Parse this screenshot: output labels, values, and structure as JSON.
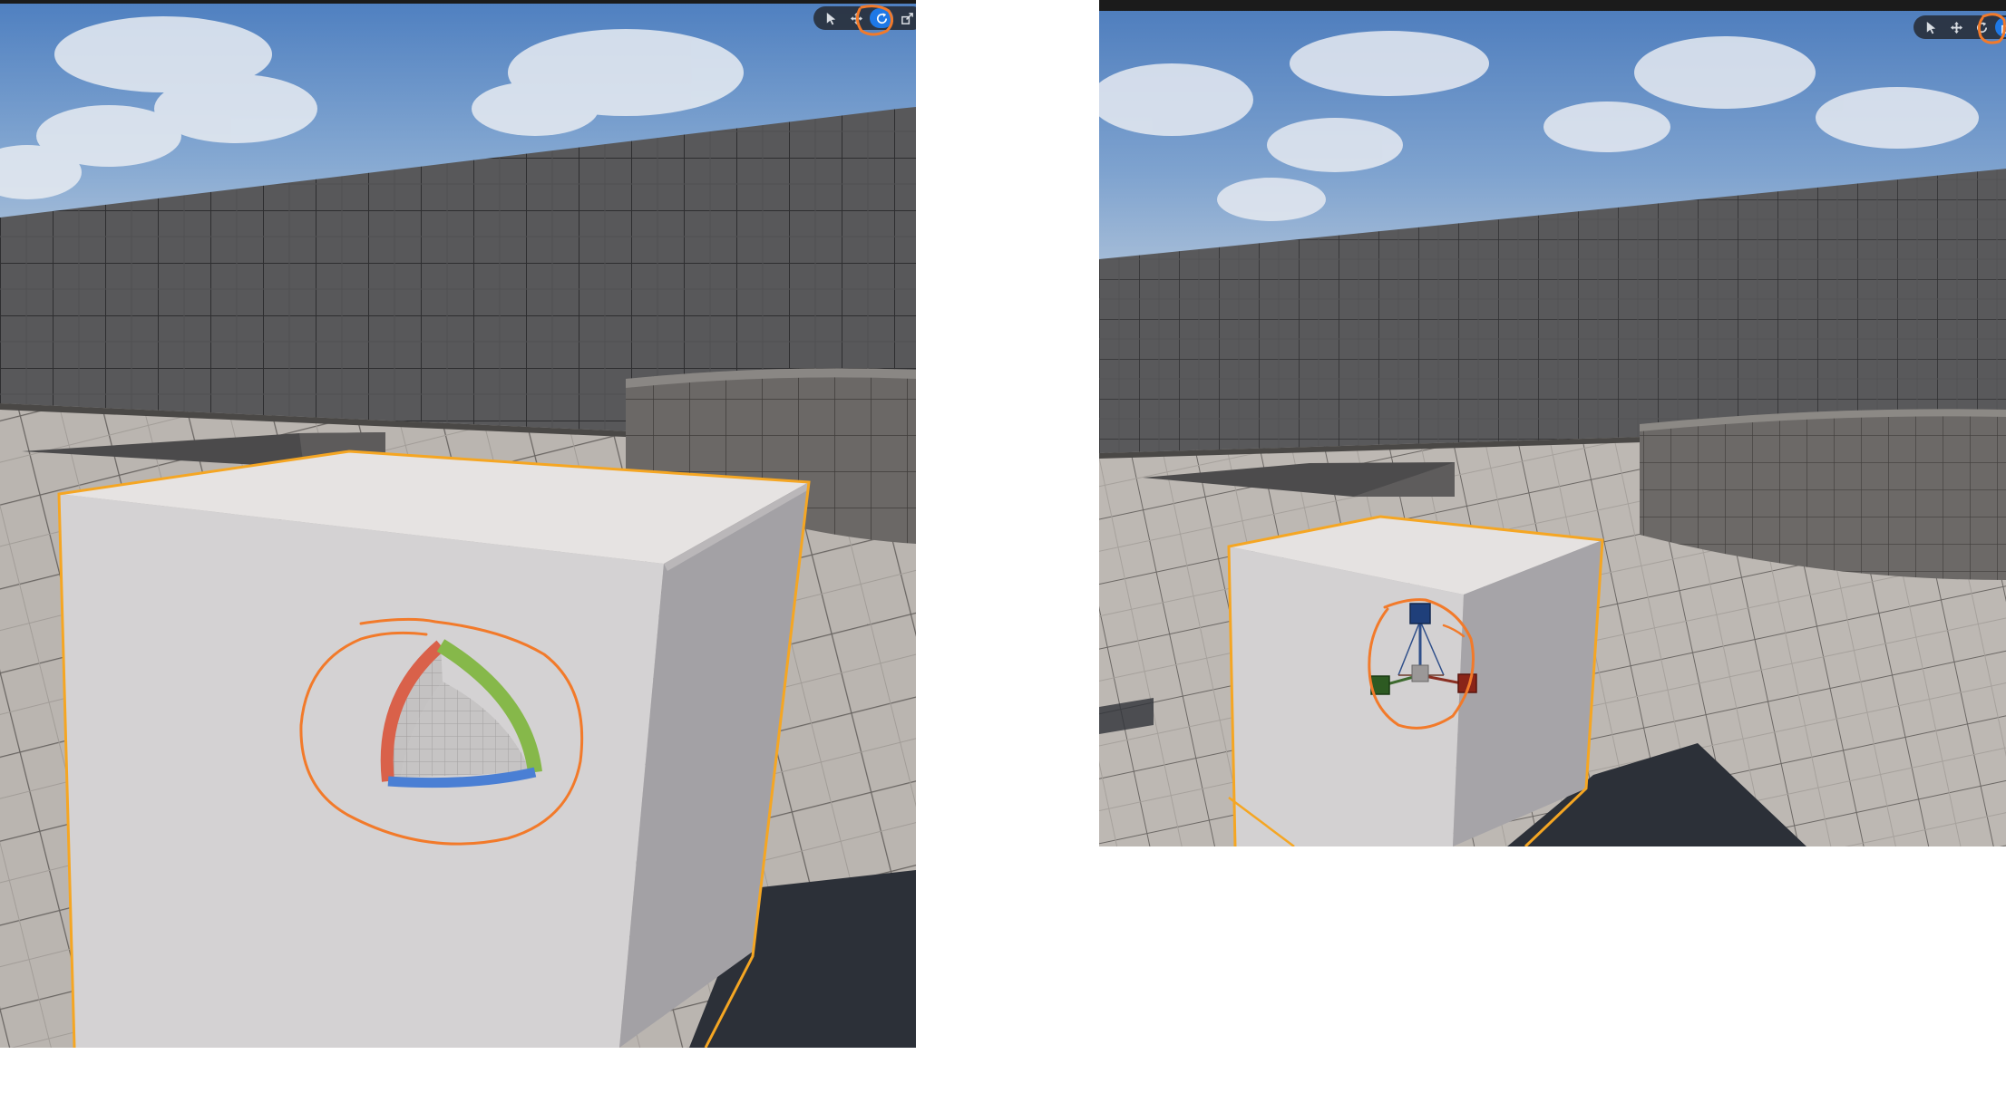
{
  "left_viewport": {
    "toolbar": {
      "tools": [
        {
          "name": "select",
          "icon": "cursor-arrow-icon",
          "active": false
        },
        {
          "name": "translate",
          "icon": "move-arrows-icon",
          "active": false
        },
        {
          "name": "rotate",
          "icon": "rotate-icon",
          "active": true
        },
        {
          "name": "scale",
          "icon": "scale-icon",
          "active": false
        }
      ]
    },
    "gizmo": {
      "type": "rotate",
      "icon": "rotation-gizmo-icon"
    }
  },
  "right_viewport": {
    "toolbar": {
      "tools": [
        {
          "name": "select",
          "icon": "cursor-arrow-icon",
          "active": false
        },
        {
          "name": "translate",
          "icon": "move-arrows-icon",
          "active": false
        },
        {
          "name": "rotate",
          "icon": "rotate-icon",
          "active": false
        },
        {
          "name": "scale",
          "icon": "scale-icon",
          "active": true
        }
      ]
    },
    "gizmo": {
      "type": "scale",
      "icon": "scale-gizmo-icon"
    }
  },
  "colors": {
    "selection_outline": "#f5a623",
    "annotation": "#f27a2a",
    "active_tool": "#1e78e6",
    "axis_x": "#d9614a",
    "axis_y": "#86b84a",
    "axis_z": "#4a7fd4"
  }
}
